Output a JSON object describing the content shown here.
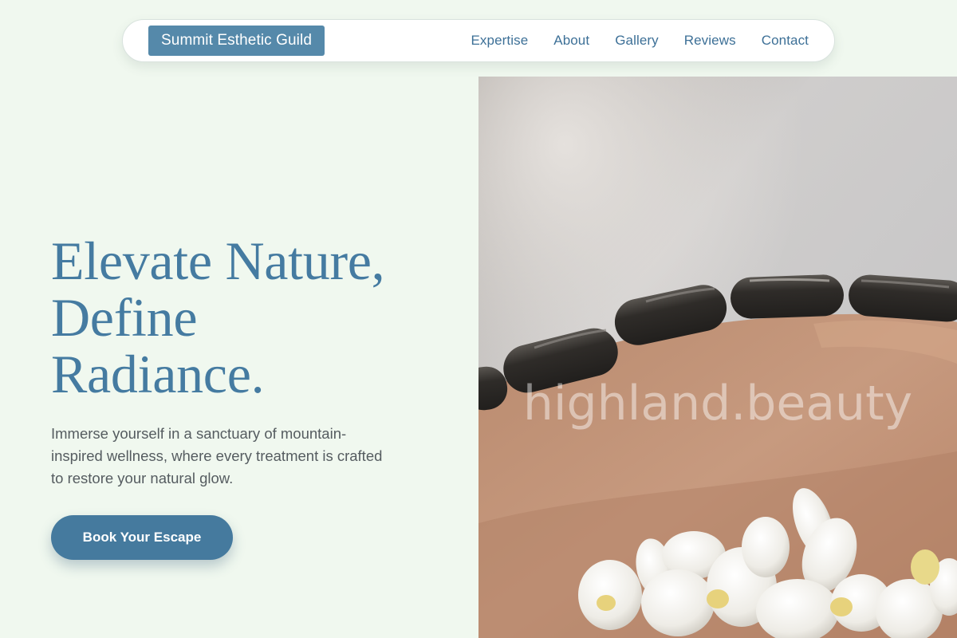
{
  "brand": {
    "name": "Summit Esthetic Guild"
  },
  "nav": {
    "links": [
      "Expertise",
      "About",
      "Gallery",
      "Reviews",
      "Contact"
    ]
  },
  "hero": {
    "title_lines": [
      "Elevate Nature,",
      "Define",
      "Radiance."
    ],
    "description": "Immerse yourself in a sanctuary of mountain-inspired wellness, where every treatment is crafted to restore your natural glow.",
    "cta_label": "Book Your Escape"
  },
  "image": {
    "watermark": "highland.beauty",
    "subject": "hot-stone-massage-photo"
  },
  "colors": {
    "background": "#f0f8ef",
    "brand_bg": "#5589aa",
    "accent": "#457ba1",
    "cta_bg": "#457a9e",
    "body_text": "#555c60"
  }
}
